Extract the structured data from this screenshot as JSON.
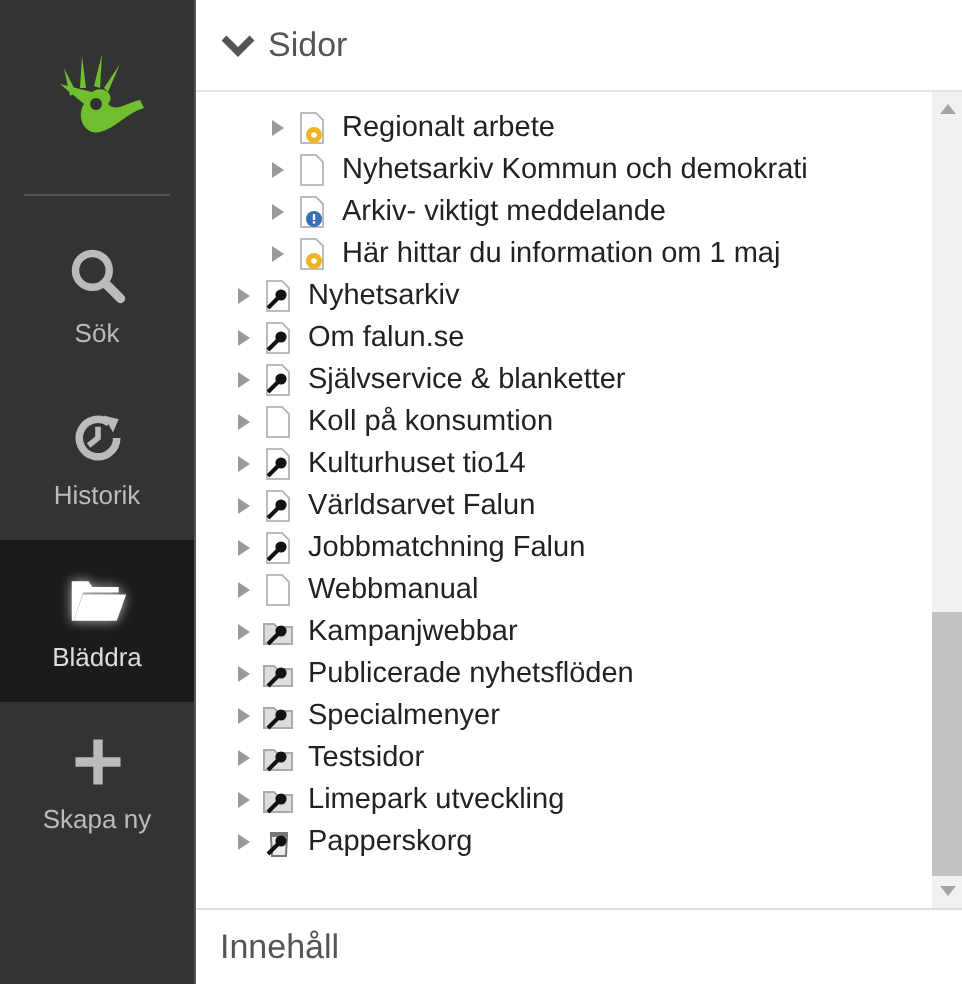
{
  "sidebar": {
    "items": [
      {
        "label": "Sök",
        "kind": "search",
        "selected": false
      },
      {
        "label": "Historik",
        "kind": "history",
        "selected": false
      },
      {
        "label": "Bläddra",
        "kind": "browse",
        "selected": true
      },
      {
        "label": "Skapa ny",
        "kind": "create",
        "selected": false
      }
    ]
  },
  "pages_panel": {
    "title": "Sidor",
    "expanded": true
  },
  "tree": {
    "items": [
      {
        "children": [
          {
            "label": "Regionalt arbete",
            "kind": "page-pending"
          },
          {
            "label": "Nyhetsarkiv Kommun och demokrati",
            "kind": "page"
          },
          {
            "label": "Arkiv- viktigt meddelande",
            "kind": "page-info"
          },
          {
            "label": "Här hittar du information om 1 maj",
            "kind": "page-pending"
          }
        ]
      },
      {
        "label": "Nyhetsarkiv",
        "kind": "page-key"
      },
      {
        "label": "Om falun.se",
        "kind": "page-key"
      },
      {
        "label": "Självservice & blanketter",
        "kind": "page-key"
      },
      {
        "label": "Koll på konsumtion",
        "kind": "page"
      },
      {
        "label": "Kulturhuset tio14",
        "kind": "page-key"
      },
      {
        "label": "Världsarvet Falun",
        "kind": "page-key"
      },
      {
        "label": "Jobbmatchning Falun",
        "kind": "page-key"
      },
      {
        "label": "Webbmanual",
        "kind": "page"
      },
      {
        "label": "Kampanjwebbar",
        "kind": "folder-key"
      },
      {
        "label": "Publicerade nyhetsflöden",
        "kind": "folder-key"
      },
      {
        "label": "Specialmenyer",
        "kind": "folder-key"
      },
      {
        "label": "Testsidor",
        "kind": "folder-key"
      },
      {
        "label": "Limepark utveckling",
        "kind": "folder-key"
      },
      {
        "label": "Papperskorg",
        "kind": "trash"
      }
    ]
  },
  "content_panel": {
    "title": "Innehåll"
  }
}
